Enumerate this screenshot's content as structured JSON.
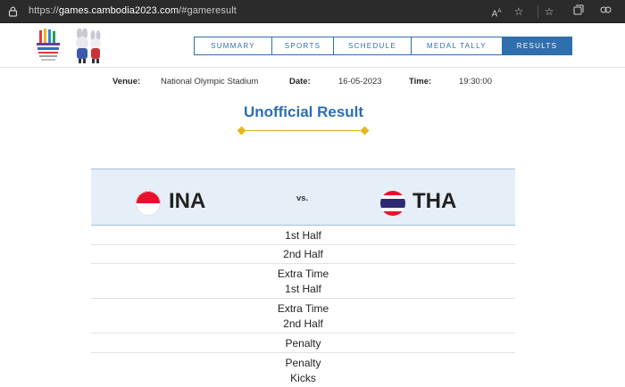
{
  "browser": {
    "url_scheme": "https://",
    "url_host": "games.cambodia2023.com",
    "url_path": "/#gameresult"
  },
  "nav": {
    "items": [
      {
        "label": "SUMMARY",
        "active": false
      },
      {
        "label": "SPORTS",
        "active": false
      },
      {
        "label": "SCHEDULE",
        "active": false
      },
      {
        "label": "MEDAL TALLY",
        "active": false
      },
      {
        "label": "RESULTS",
        "active": true
      }
    ]
  },
  "match_info": {
    "venue_label": "Venue:",
    "venue": "National Olympic Stadium",
    "date_label": "Date:",
    "date": "16-05-2023",
    "time_label": "Time:",
    "time": "19:30:00"
  },
  "result_title": "Unofficial Result",
  "teams": {
    "home": "INA",
    "away": "THA",
    "vs": "vs."
  },
  "periods": [
    [
      "1st Half"
    ],
    [
      "2nd Half"
    ],
    [
      "Extra Time",
      "1st Half"
    ],
    [
      "Extra Time",
      "2nd Half"
    ],
    [
      "Penalty"
    ],
    [
      "Penalty",
      "Kicks"
    ]
  ],
  "colors": {
    "accent": "#2f6fae",
    "title": "#2a6eb2",
    "gold": "#e7b423",
    "team_row_bg": "#e6eff7"
  }
}
